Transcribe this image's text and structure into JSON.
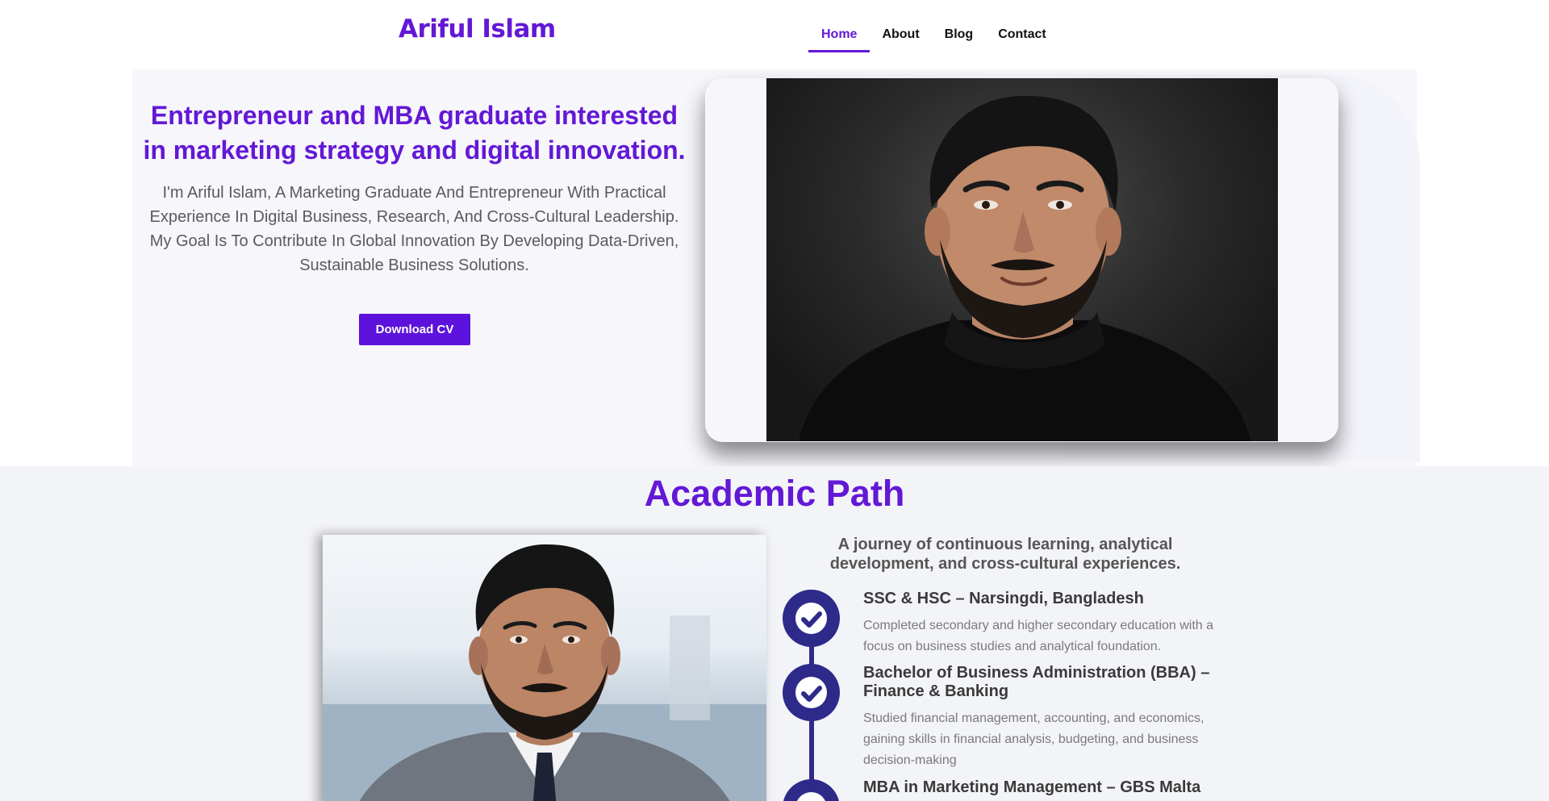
{
  "header": {
    "brand": "Ariful Islam",
    "nav": [
      {
        "label": "Home",
        "active": true
      },
      {
        "label": "About",
        "active": false
      },
      {
        "label": "Blog",
        "active": false
      },
      {
        "label": "Contact",
        "active": false
      }
    ]
  },
  "hero": {
    "title": "Entrepreneur and MBA graduate interested in marketing strategy and digital innovation.",
    "description": "I'm Ariful Islam, A Marketing Graduate And Entrepreneur With Practical Experience In Digital Business, Research, And Cross-Cultural Leadership. My Goal Is To Contribute In Global Innovation By Developing Data-Driven, Sustainable Business Solutions.",
    "cv_button": "Download CV"
  },
  "academic": {
    "title": "Academic Path",
    "intro": "A journey of continuous learning, analytical development, and cross-cultural experiences.",
    "items": [
      {
        "title": "SSC & HSC – Narsingdi, Bangladesh",
        "description": "Completed secondary and higher secondary education with a focus on business studies and analytical foundation."
      },
      {
        "title": "Bachelor of Business Administration (BBA) – Finance & Banking",
        "description": "Studied financial management, accounting, and economics, gaining skills in financial analysis, budgeting, and business decision-making"
      },
      {
        "title": "MBA in Marketing Management – GBS Malta",
        "description": ""
      }
    ]
  },
  "colors": {
    "accent": "#6318d6",
    "button": "#5c12dc",
    "timeline": "#2e2a8a",
    "hero_bg": "#f6f6fb",
    "section_bg": "#f3f4f8"
  },
  "icons": {
    "timeline_marker": "check-circle-icon"
  }
}
